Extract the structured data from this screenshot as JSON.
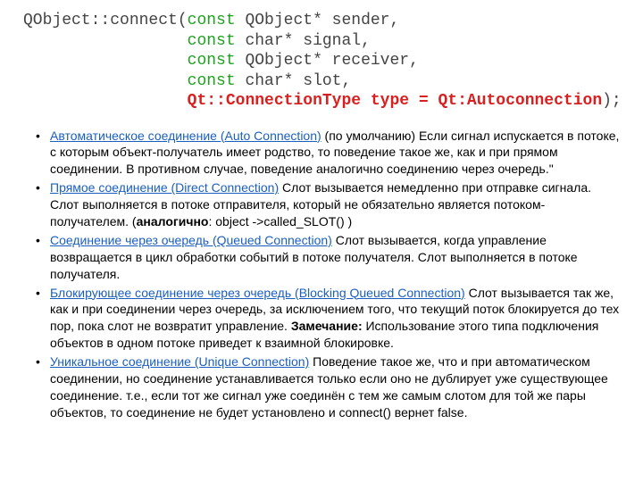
{
  "code": {
    "prefix": "QObject::connect(",
    "lines": [
      {
        "kw": "const",
        "rest": " QObject* sender,",
        "indent": ""
      },
      {
        "kw": "const",
        "rest": " char* signal,",
        "indent": "                 "
      },
      {
        "kw": "const",
        "rest": " QObject* receiver,",
        "indent": "                 "
      },
      {
        "kw": "const",
        "rest": " char* slot,",
        "indent": "                 "
      }
    ],
    "last_indent": "                 ",
    "last_red": "Qt::ConnectionType type = Qt:Autoconnection",
    "last_tail": ");"
  },
  "items": [
    {
      "link": "Автоматическое соединение (Auto Connection)",
      "text": " (по умолчанию) Если сигнал испускается в потоке, с которым объект-получатель имеет родство, то поведение такое же, как и при прямом соединении. В противном случае, поведение аналогично соединению через очередь.\""
    },
    {
      "link": "Прямое соединение (Direct Connection)",
      "text_pre": " Слот вызывается немедленно при отправке сигнала. Слот выполняется в потоке отправителя, который не обязательно является потоком-получателем. (",
      "bold": "аналогично",
      "text_post": ": object ->called_SLOT() )"
    },
    {
      "link": "Соединение через очередь (Queued Connection)",
      "text": " Слот вызывается, когда управление возвращается в цикл обработки событий в потоке получателя. Слот выполняется в потоке получателя."
    },
    {
      "link": "Блокирующее соединение через очередь (Blocking Queued Connection)",
      "text_pre": " Слот вызывается так же, как и при соединении через очередь, за исключением того, что текущий поток блокируется до тех пор, пока слот не возвратит управление. ",
      "bold": "Замечание:",
      "text_post": " Использование этого типа подключения объектов в одном потоке приведет к взаимной блокировке."
    },
    {
      "link": "Уникальное соединение (Unique Connection)",
      "text": " Поведение такое же, что и при автоматическом соединении, но соединение устанавливается только если оно не дублирует уже существующее соединение. т.е., если тот же сигнал уже соединён с тем же самым слотом для той же пары объектов, то соединение не будет установлено и connect() вернет false."
    }
  ]
}
